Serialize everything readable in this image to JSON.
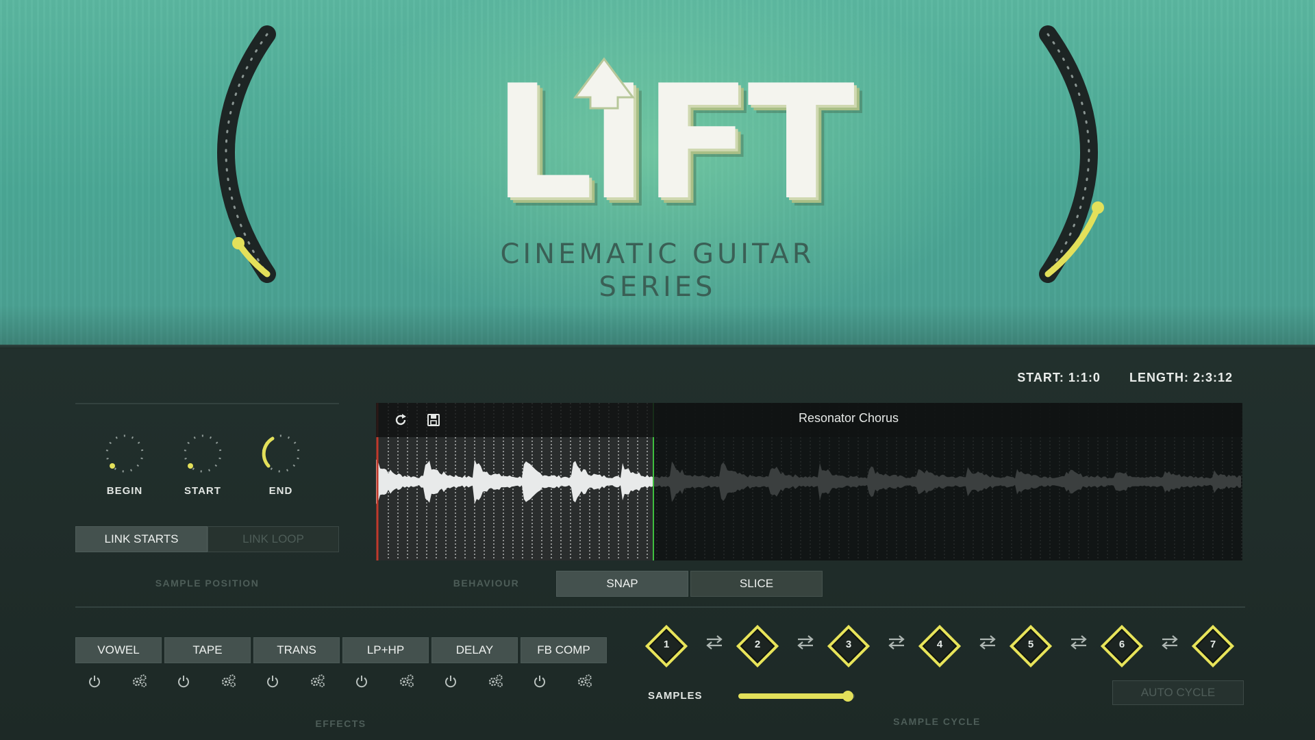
{
  "header": {
    "logo_title": "LIFT",
    "logo_subtitle_line1": "CINEMATIC GUITAR",
    "logo_subtitle_line2": "SERIES",
    "left_arc_value": 0.1,
    "right_arc_value": 0.3,
    "accent_color": "#e3e05a"
  },
  "position": {
    "start_label": "START: 1:1:0",
    "length_label": "LENGTH: 2:3:12"
  },
  "sample_position": {
    "section_label": "SAMPLE POSITION",
    "knobs": [
      {
        "label": "BEGIN",
        "value": 0.0
      },
      {
        "label": "START",
        "value": 0.0
      },
      {
        "label": "END",
        "value": 0.35
      }
    ],
    "link_starts": "LINK STARTS",
    "link_loop": "LINK LOOP"
  },
  "waveform": {
    "sample_name": "Resonator Chorus",
    "refresh_icon": "refresh-icon",
    "save_icon": "save-icon",
    "highlight_end_fraction": 0.32
  },
  "behaviour": {
    "section_label": "BEHAVIOUR",
    "snap": "SNAP",
    "slice": "SLICE"
  },
  "effects": {
    "section_label": "EFFECTS",
    "items": [
      "VOWEL",
      "TAPE",
      "TRANS",
      "LP+HP",
      "DELAY",
      "FB COMP"
    ]
  },
  "sample_cycle": {
    "section_label": "SAMPLE CYCLE",
    "slots": [
      "1",
      "2",
      "3",
      "4",
      "5",
      "6",
      "7"
    ],
    "samples_label": "SAMPLES",
    "samples_value": 1.0,
    "auto_cycle": "AUTO CYCLE"
  }
}
